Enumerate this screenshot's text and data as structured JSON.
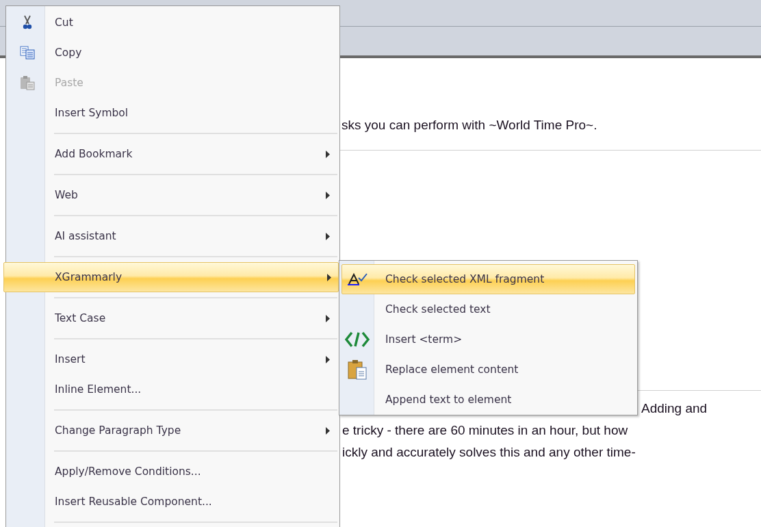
{
  "document": {
    "lines": [
      {
        "text": "sks you can perform with ~World Time Pro~.",
        "kind": "top"
      },
      {
        "text": "Adding and",
        "kind": "right"
      },
      {
        "text": "e tricky - there are 60 minutes in an hour, but how",
        "kind": "left"
      },
      {
        "text": "ickly and accurately solves this and any other time-",
        "kind": "left"
      }
    ]
  },
  "context_menu": {
    "items": [
      {
        "kind": "item",
        "label": "Cut",
        "disabled": false,
        "submenu": false,
        "selected": false
      },
      {
        "kind": "item",
        "label": "Copy",
        "disabled": false,
        "submenu": false,
        "selected": false
      },
      {
        "kind": "item",
        "label": "Paste",
        "disabled": true,
        "submenu": false,
        "selected": false
      },
      {
        "kind": "item",
        "label": "Insert Symbol",
        "disabled": false,
        "submenu": false,
        "selected": false
      },
      {
        "kind": "separator"
      },
      {
        "kind": "item",
        "label": "Add Bookmark",
        "disabled": false,
        "submenu": true,
        "selected": false
      },
      {
        "kind": "separator"
      },
      {
        "kind": "item",
        "label": "Web",
        "disabled": false,
        "submenu": true,
        "selected": false
      },
      {
        "kind": "separator"
      },
      {
        "kind": "item",
        "label": "AI assistant",
        "disabled": false,
        "submenu": true,
        "selected": false
      },
      {
        "kind": "separator"
      },
      {
        "kind": "item",
        "label": "XGrammarly",
        "disabled": false,
        "submenu": true,
        "selected": true
      },
      {
        "kind": "separator"
      },
      {
        "kind": "item",
        "label": "Text Case",
        "disabled": false,
        "submenu": true,
        "selected": false
      },
      {
        "kind": "separator"
      },
      {
        "kind": "item",
        "label": "Insert",
        "disabled": false,
        "submenu": true,
        "selected": false
      },
      {
        "kind": "item",
        "label": "Inline Element...",
        "disabled": false,
        "submenu": false,
        "selected": false
      },
      {
        "kind": "separator"
      },
      {
        "kind": "item",
        "label": "Change Paragraph Type",
        "disabled": false,
        "submenu": true,
        "selected": false
      },
      {
        "kind": "separator"
      },
      {
        "kind": "item",
        "label": "Apply/Remove Conditions...",
        "disabled": false,
        "submenu": false,
        "selected": false
      },
      {
        "kind": "item",
        "label": "Insert Reusable Component...",
        "disabled": false,
        "submenu": false,
        "selected": false
      },
      {
        "kind": "separator"
      }
    ]
  },
  "submenu": {
    "items": [
      {
        "label": "Check selected XML fragment",
        "selected": true
      },
      {
        "label": "Check selected text",
        "selected": false
      },
      {
        "label": "Insert <term>",
        "selected": false
      },
      {
        "label": "Replace element content",
        "selected": false
      },
      {
        "label": "Append text to element",
        "selected": false
      }
    ]
  }
}
